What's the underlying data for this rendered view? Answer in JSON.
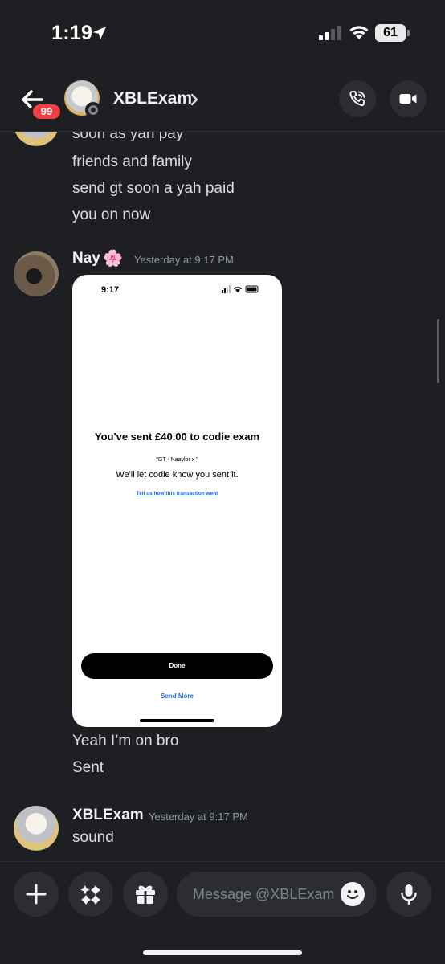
{
  "status_bar": {
    "time": "1:19",
    "battery": "61"
  },
  "header": {
    "back_badge": "99",
    "channel_name": "XBLExam"
  },
  "messages": {
    "continued_lines": [
      "soon as yah pay",
      "friends and family",
      "send gt soon a yah paid",
      "you on now"
    ],
    "nay": {
      "author": "Nay",
      "author_emoji": "🌸",
      "timestamp": "Yesterday at 9:17 PM",
      "attachment": {
        "time": "9:17",
        "title": "You've sent £40.00 to codie exam",
        "note": "\"GT - Naaylor x \"",
        "subtitle": "We'll let codie know you sent it.",
        "link": "Tell us how this transaction went",
        "done_label": "Done",
        "send_more_label": "Send More"
      },
      "lines": [
        "Yeah I’m on bro",
        "Sent"
      ]
    },
    "xblexam": {
      "author": "XBLExam",
      "timestamp": "Yesterday at 9:17 PM",
      "lines": [
        "sound"
      ]
    }
  },
  "composer": {
    "placeholder": "Message @XBLExam"
  },
  "icons": {
    "back": "arrow-left-icon",
    "call": "phone-call-icon",
    "video": "video-camera-icon",
    "plus": "plus-icon",
    "apps": "sparkle-apps-icon",
    "gift": "gift-icon",
    "emoji": "smiley-icon",
    "mic": "microphone-icon"
  },
  "colors": {
    "background": "#1e1f22",
    "badge": "#f23f43",
    "link": "#1a6ce0"
  }
}
